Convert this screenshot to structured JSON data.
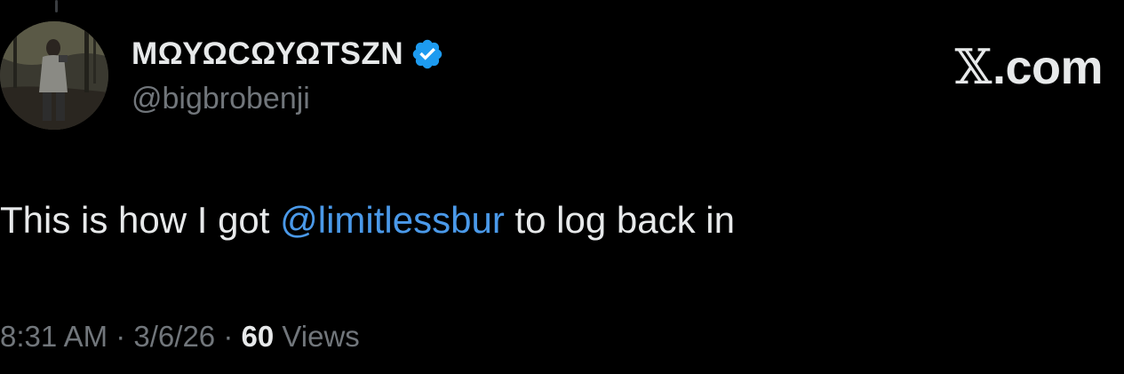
{
  "colors": {
    "background": "#000000",
    "primary_text": "#e7e9ea",
    "secondary_text": "#71767b",
    "link": "#4a99e9",
    "verified_badge": "#1d9bf0"
  },
  "author": {
    "display_name": "ΜΩΥΩϹΩΥΩTSZN",
    "handle": "@bigbrobenji",
    "verified_icon": "verified-badge-icon",
    "avatar_icon": "avatar-photo"
  },
  "brand": {
    "glyph": "𝕏",
    "suffix": ".com"
  },
  "tweet": {
    "text_before": "This is how I got ",
    "mention": "@limitlessbur",
    "text_after": " to log back in"
  },
  "meta": {
    "time": "8:31 AM",
    "separator_1": " · ",
    "date": "3/6/26",
    "separator_2": " · ",
    "views_count": "60",
    "views_label": " Views"
  }
}
